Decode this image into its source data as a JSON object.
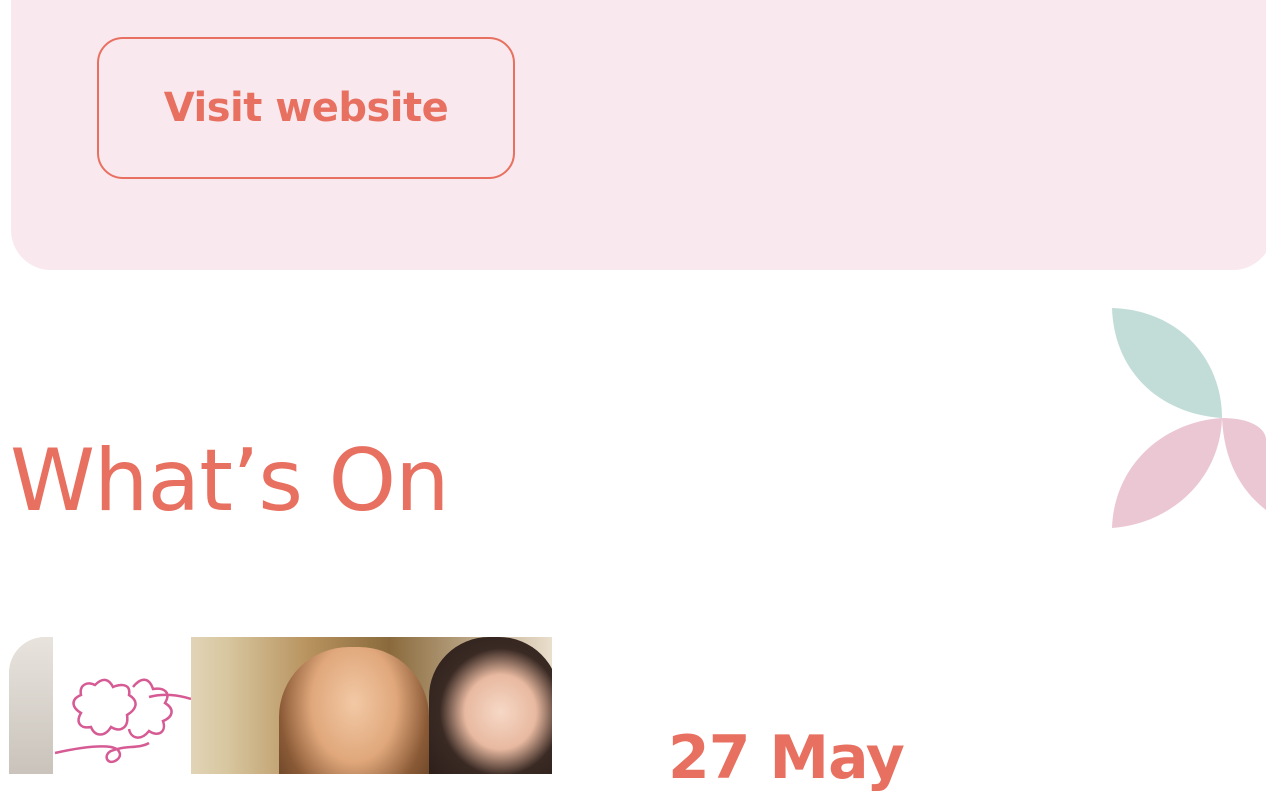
{
  "visit_section": {
    "button_label": "Visit website"
  },
  "whats_on": {
    "heading": "What’s On"
  },
  "event": {
    "date": "27 May",
    "image_icon": "star-outline-logo"
  },
  "colors": {
    "accent": "#e87060",
    "card_background": "#f9e9ef",
    "teal_leaf": "#c2ddd8",
    "pink_leaf": "#ebc6d3",
    "logo_stroke": "#d65a93"
  }
}
